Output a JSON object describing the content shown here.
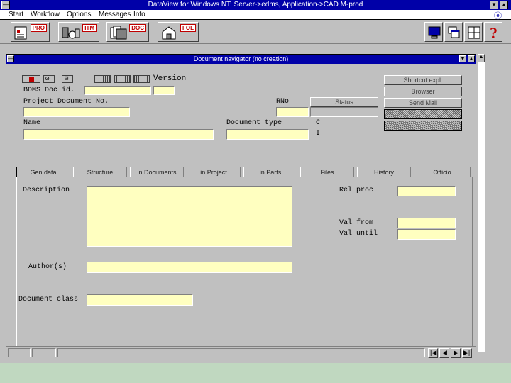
{
  "app": {
    "title": "DataView for Windows NT: Server->edms, Application->CAD M-prod",
    "menu": [
      "Start",
      "Workflow",
      "Options",
      "Messages",
      "Info"
    ],
    "toolbar_buttons": [
      {
        "label": "PRO",
        "icon": "product-icon"
      },
      {
        "label": "ITM",
        "icon": "item-icon"
      },
      {
        "label": "DOC",
        "icon": "document-icon"
      },
      {
        "label": "FOL",
        "icon": "folder-icon"
      }
    ]
  },
  "child": {
    "title": "Document navigator (no creation)",
    "header": {
      "version_label": "Version",
      "doc_id_label": "BDMS Doc id.",
      "project_doc_label": "Project Document No.",
      "rno_label": "RNo",
      "status_button": "Status",
      "name_label": "Name",
      "doc_type_label": "Document type",
      "doc_type_flag": "C",
      "doc_type_flag2": "I"
    },
    "side_buttons": [
      "Shortcut expl.",
      "Browser",
      "Send Mail"
    ],
    "tabs": [
      "Gen.data",
      "Structure",
      "in Documents",
      "in Project",
      "in Parts",
      "Files",
      "History",
      "Officio"
    ],
    "active_tab": 0,
    "general": {
      "description_label": "Description",
      "rel_proc_label": "Rel proc",
      "val_from_label": "Val from",
      "val_until_label": "Val until",
      "authors_label": "Author(s)",
      "doc_class_label": "Document class"
    }
  },
  "colors": {
    "titlebar": "#0000a8",
    "field_bg": "#ffffc0",
    "desktop": "#cfe3cc"
  }
}
